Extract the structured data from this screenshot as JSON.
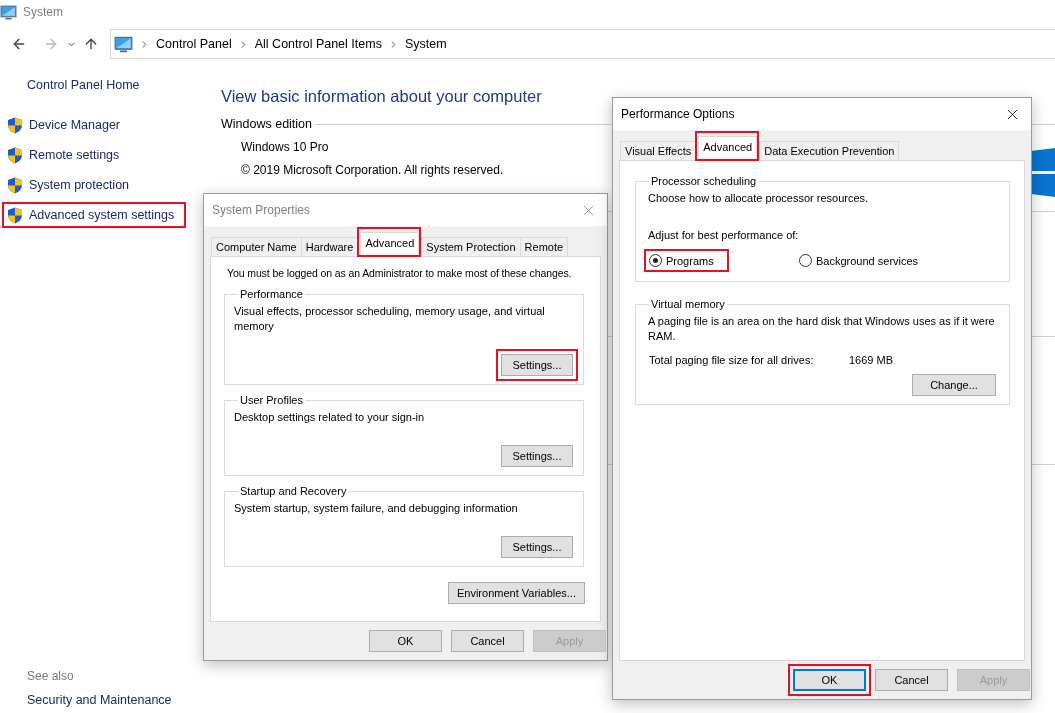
{
  "window": {
    "title": "System",
    "active": false
  },
  "address": {
    "crumbs": [
      "Control Panel",
      "All Control Panel Items",
      "System"
    ]
  },
  "sidebar": {
    "home": "Control Panel Home",
    "items": [
      {
        "label": "Device Manager",
        "highlighted": false
      },
      {
        "label": "Remote settings",
        "highlighted": false
      },
      {
        "label": "System protection",
        "highlighted": false
      },
      {
        "label": "Advanced system settings",
        "highlighted": true
      }
    ],
    "see_also": {
      "heading": "See also",
      "links": [
        "Security and Maintenance"
      ]
    }
  },
  "main": {
    "heading": "View basic information about your computer",
    "sections": [
      {
        "title": "Windows edition",
        "lines": [
          "Windows 10 Pro",
          "© 2019 Microsoft Corporation. All rights reserved."
        ]
      }
    ]
  },
  "system_properties": {
    "title": "System Properties",
    "active": false,
    "tabs": [
      {
        "label": "Computer Name",
        "selected": false,
        "highlighted": false
      },
      {
        "label": "Hardware",
        "selected": false,
        "highlighted": false
      },
      {
        "label": "Advanced",
        "selected": true,
        "highlighted": true
      },
      {
        "label": "System Protection",
        "selected": false,
        "highlighted": false
      },
      {
        "label": "Remote",
        "selected": false,
        "highlighted": false
      }
    ],
    "notice": "You must be logged on as an Administrator to make most of these changes.",
    "groups": [
      {
        "title": "Performance",
        "description": "Visual effects, processor scheduling, memory usage, and virtual memory",
        "button": {
          "label": "Settings...",
          "highlighted": true
        }
      },
      {
        "title": "User Profiles",
        "description": "Desktop settings related to your sign-in",
        "button": {
          "label": "Settings...",
          "highlighted": false
        }
      },
      {
        "title": "Startup and Recovery",
        "description": "System startup, system failure, and debugging information",
        "button": {
          "label": "Settings...",
          "highlighted": false
        }
      }
    ],
    "extra_button": {
      "label": "Environment Variables...",
      "highlighted": false
    },
    "buttons": [
      {
        "label": "OK",
        "disabled": false,
        "focused": false,
        "highlighted": false
      },
      {
        "label": "Cancel",
        "disabled": false,
        "focused": false,
        "highlighted": false
      },
      {
        "label": "Apply",
        "disabled": true,
        "focused": false,
        "highlighted": false
      }
    ]
  },
  "performance_options": {
    "title": "Performance Options",
    "active": true,
    "tabs": [
      {
        "label": "Visual Effects",
        "selected": false,
        "highlighted": false
      },
      {
        "label": "Advanced",
        "selected": true,
        "highlighted": true
      },
      {
        "label": "Data Execution Prevention",
        "selected": false,
        "highlighted": false
      }
    ],
    "groups": [
      {
        "kind": "radio",
        "title": "Processor scheduling",
        "description": "Choose how to allocate processor resources.",
        "prompt": "Adjust for best performance of:",
        "options": [
          {
            "label": "Programs",
            "selected": true,
            "highlighted": true
          },
          {
            "label": "Background services",
            "selected": false,
            "highlighted": false
          }
        ]
      },
      {
        "kind": "memory",
        "title": "Virtual memory",
        "description": "A paging file is an area on the hard disk that Windows uses as if it were RAM.",
        "total_label": "Total paging file size for all drives:",
        "total_value": "1669 MB",
        "button": {
          "label": "Change...",
          "highlighted": false
        }
      }
    ],
    "buttons": [
      {
        "label": "OK",
        "disabled": false,
        "focused": true,
        "highlighted": true
      },
      {
        "label": "Cancel",
        "disabled": false,
        "focused": false,
        "highlighted": false
      },
      {
        "label": "Apply",
        "disabled": true,
        "focused": false,
        "highlighted": false
      }
    ]
  }
}
